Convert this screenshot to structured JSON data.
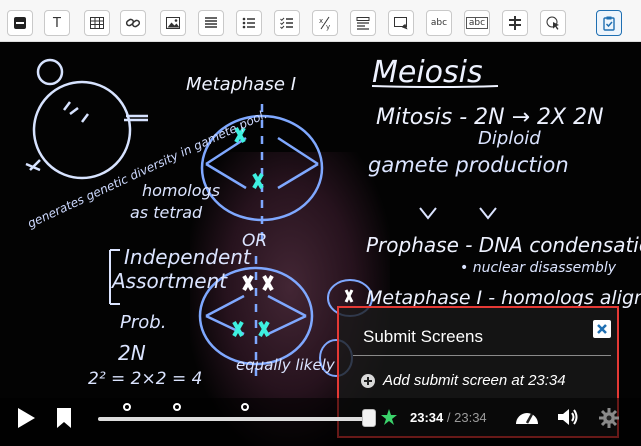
{
  "toolbar": {
    "buttons": [
      {
        "name": "minus-block-icon"
      },
      {
        "name": "text-icon",
        "glyph": "T"
      },
      {
        "name": "table-icon"
      },
      {
        "name": "link-icon"
      },
      {
        "name": "image-icon"
      },
      {
        "name": "align-icon"
      },
      {
        "name": "bulleted-list-icon"
      },
      {
        "name": "checklist-icon"
      },
      {
        "name": "fraction-icon",
        "glyph": "⁄"
      },
      {
        "name": "outline-icon"
      },
      {
        "name": "screen-select-icon"
      },
      {
        "name": "abc-text-icon",
        "glyph": "abc"
      },
      {
        "name": "abc-box-icon",
        "glyph": "abc"
      },
      {
        "name": "split-icon"
      },
      {
        "name": "cursor-icon"
      },
      {
        "name": "clipboard-check-icon"
      }
    ],
    "active_color": "#1f6fb2"
  },
  "board": {
    "meiosis": "Meiosis",
    "mitosis": "Mitosis - 2N → 2X 2N",
    "diploid": "Diploid",
    "gamete": "gamete production",
    "metaphase1": "Metaphase I",
    "prophase": "Prophase - DNA condensation",
    "nuclear": "• nuclear disassembly",
    "metaphase_line": "Metaphase I - homologs align",
    "homologs": "homologs",
    "tetrad": "as tetrad",
    "independent": "Independent",
    "assortment": "Assortment",
    "prob": "Prob.",
    "two_n": "2N",
    "equation": "2² = 2×2 = 4",
    "equally": "equally likely",
    "or": "OR",
    "generates": "generates genetic diversity in gamete pool."
  },
  "player": {
    "current_time": "23:34",
    "separator": "/",
    "duration": "23:34",
    "progress_fraction": 1.0
  },
  "popup": {
    "title": "Submit Screens",
    "add_label": "Add submit screen at 23:34",
    "border_color": "#e53935"
  }
}
